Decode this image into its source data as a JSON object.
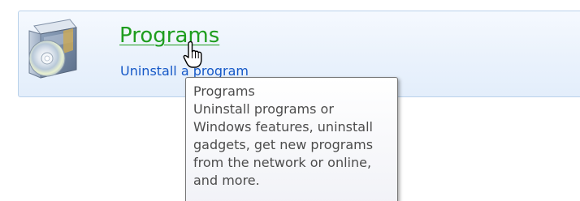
{
  "category": {
    "title": "Programs",
    "sub_link": "Uninstall a program",
    "icon": "programs-box-with-disc-icon"
  },
  "tooltip": {
    "title": "Programs",
    "body": "Uninstall programs or Windows features, uninstall gadgets, get new programs from the network or online, and more."
  },
  "cursor": {
    "icon": "hand-pointer-icon"
  },
  "colors": {
    "title_link": "#1e9d1e",
    "sub_link": "#1558c7",
    "card_border": "#b9d1ea",
    "tooltip_text": "#4c4c4c"
  }
}
